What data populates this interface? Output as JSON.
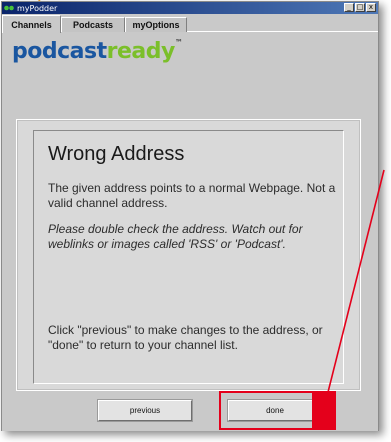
{
  "window": {
    "title": "myPodder",
    "controls": [
      "_",
      "□",
      "x"
    ]
  },
  "tabs": [
    {
      "label": "Channels",
      "active": true
    },
    {
      "label": "Podcasts",
      "active": false
    },
    {
      "label": "myOptions",
      "active": false
    }
  ],
  "logo": {
    "part1": "podcast",
    "part2": "ready",
    "tm": "™"
  },
  "message": {
    "title": "Wrong Address",
    "body": "The given address points to a normal Webpage. Not a valid channel address.",
    "hint": "Please double check the address. Watch out for weblinks or images called 'RSS' or 'Podcast'.",
    "instructions": "Click \"previous\" to make changes to the address, or \"done\" to return to your channel list."
  },
  "buttons": {
    "previous": "previous",
    "done": "done"
  },
  "colors": {
    "titlebar": "#0a246a",
    "logo_blue": "#1a56a0",
    "logo_green": "#7bbf2a",
    "highlight_red": "#e4001b"
  }
}
